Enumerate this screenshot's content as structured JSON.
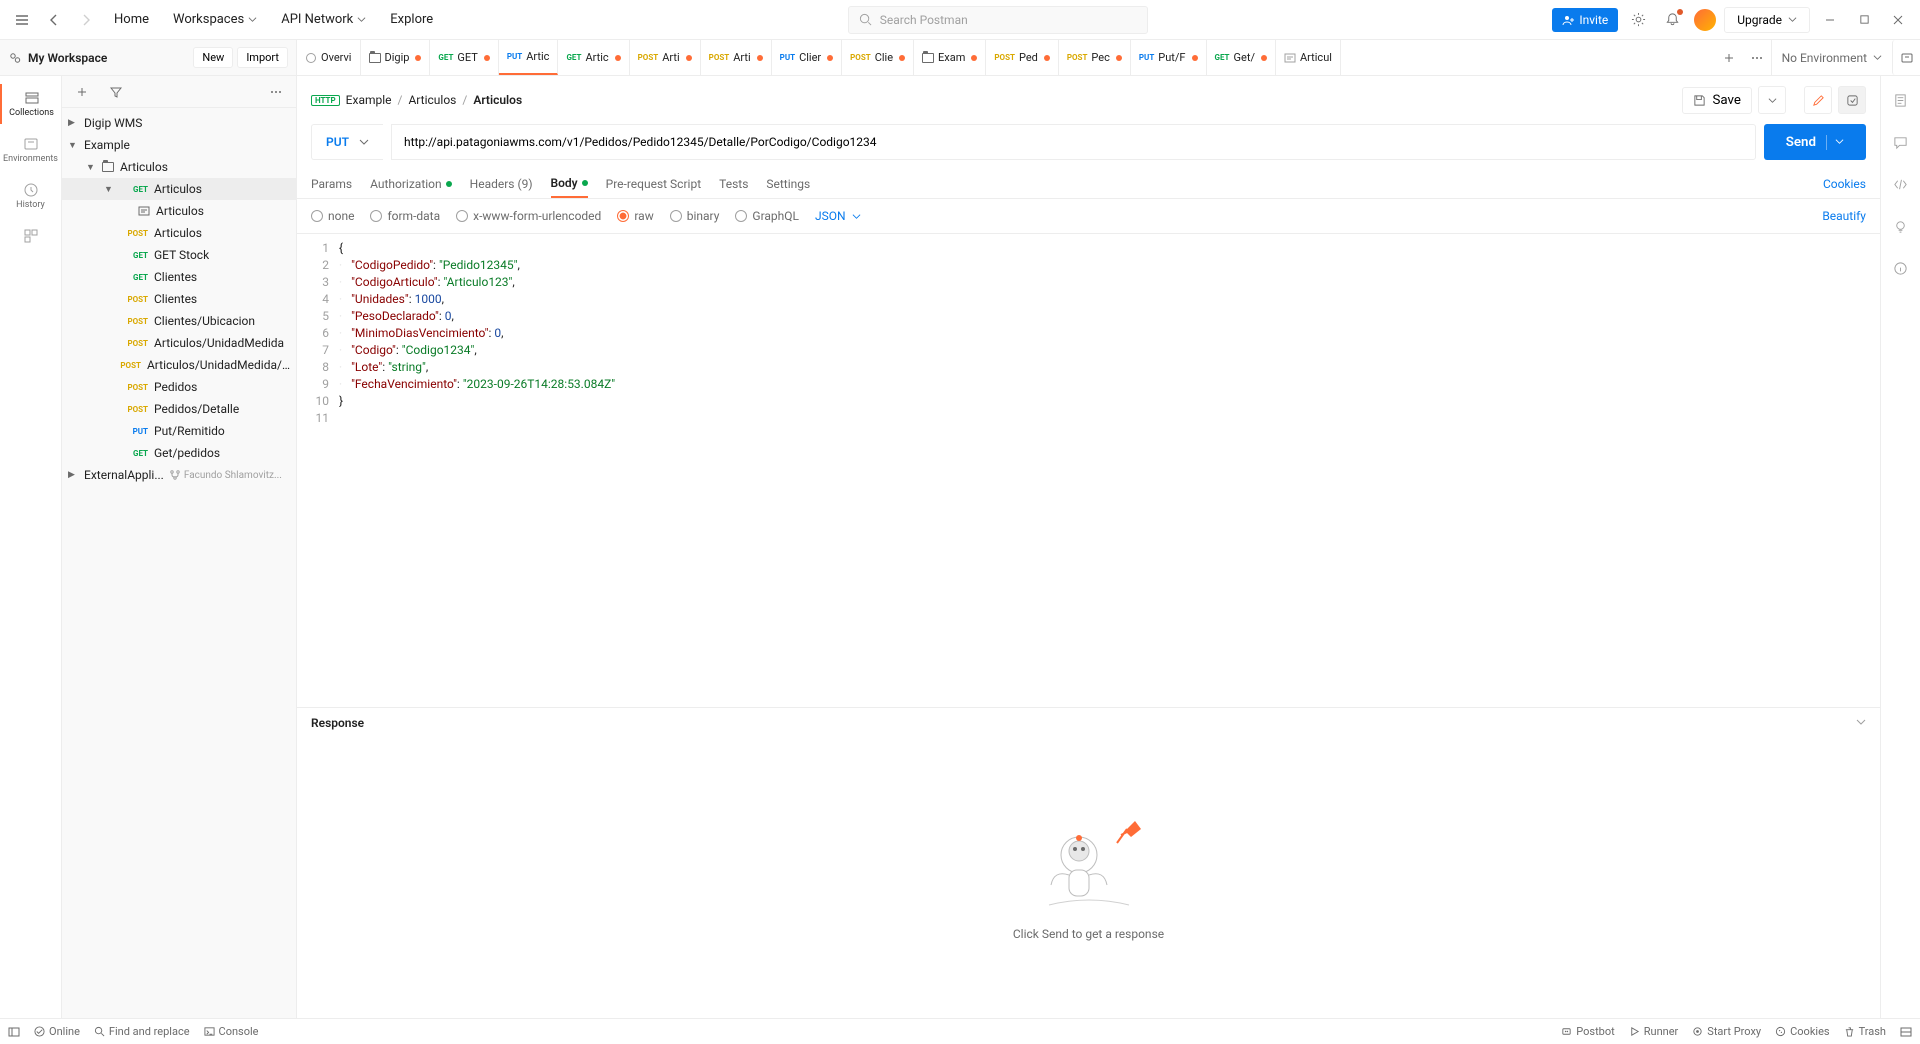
{
  "header": {
    "home": "Home",
    "workspaces": "Workspaces",
    "api_network": "API Network",
    "explore": "Explore",
    "search_placeholder": "Search Postman",
    "invite": "Invite",
    "upgrade": "Upgrade"
  },
  "workspace": {
    "name": "My Workspace",
    "new_btn": "New",
    "import_btn": "Import",
    "no_env": "No Environment"
  },
  "rail": {
    "collections": "Collections",
    "environments": "Environments",
    "history": "History"
  },
  "tabs": [
    {
      "method": null,
      "label": "Overvi",
      "dirty": false,
      "icon": "overview"
    },
    {
      "method": null,
      "label": "Digip",
      "dirty": true,
      "icon": "folder"
    },
    {
      "method": "GET",
      "label": "GET",
      "dirty": true
    },
    {
      "method": "PUT",
      "label": "Artic",
      "dirty": false,
      "active": true
    },
    {
      "method": "GET",
      "label": "Artic",
      "dirty": true
    },
    {
      "method": "POST",
      "label": "Arti",
      "dirty": true
    },
    {
      "method": "POST",
      "label": "Arti",
      "dirty": true
    },
    {
      "method": "PUT",
      "label": "Clier",
      "dirty": true
    },
    {
      "method": "POST",
      "label": "Clie",
      "dirty": true
    },
    {
      "method": null,
      "label": "Exam",
      "dirty": true,
      "icon": "folder"
    },
    {
      "method": "POST",
      "label": "Ped",
      "dirty": true
    },
    {
      "method": "POST",
      "label": "Pec",
      "dirty": true
    },
    {
      "method": "PUT",
      "label": "Put/F",
      "dirty": true
    },
    {
      "method": "GET",
      "label": "Get/",
      "dirty": true
    },
    {
      "method": null,
      "label": "Articul",
      "dirty": false,
      "icon": "example"
    }
  ],
  "tree": [
    {
      "type": "col",
      "label": "Digip WMS",
      "indent": 0,
      "caret": "right"
    },
    {
      "type": "col",
      "label": "Example",
      "indent": 0,
      "caret": "down"
    },
    {
      "type": "folder",
      "label": "Articulos",
      "indent": 1,
      "caret": "down"
    },
    {
      "type": "req",
      "method": "GET",
      "label": "Articulos",
      "indent": 2,
      "caret": "down",
      "selected": true
    },
    {
      "type": "ex",
      "label": "Articulos",
      "indent": 3
    },
    {
      "type": "req",
      "method": "POST",
      "label": "Articulos",
      "indent": 2
    },
    {
      "type": "req",
      "method": "GET",
      "label": "GET Stock",
      "indent": 2
    },
    {
      "type": "req",
      "method": "GET",
      "label": "Clientes",
      "indent": 2
    },
    {
      "type": "req",
      "method": "POST",
      "label": "Clientes",
      "indent": 2
    },
    {
      "type": "req",
      "method": "POST",
      "label": "Clientes/Ubicacion",
      "indent": 2
    },
    {
      "type": "req",
      "method": "POST",
      "label": "Articulos/UnidadMedida",
      "indent": 2
    },
    {
      "type": "req",
      "method": "POST",
      "label": "Articulos/UnidadMedida/Codig...",
      "indent": 2
    },
    {
      "type": "req",
      "method": "POST",
      "label": "Pedidos",
      "indent": 2
    },
    {
      "type": "req",
      "method": "POST",
      "label": "Pedidos/Detalle",
      "indent": 2
    },
    {
      "type": "req",
      "method": "PUT",
      "label": "Put/Remitido",
      "indent": 2
    },
    {
      "type": "req",
      "method": "GET",
      "label": "Get/pedidos",
      "indent": 2
    },
    {
      "type": "col",
      "label": "ExternalAppli...",
      "indent": 0,
      "caret": "right",
      "fork": "Facundo Shlamovitz..."
    }
  ],
  "breadcrumb": {
    "api_badge": "HTTP",
    "seg1": "Example",
    "seg2": "Articulos",
    "seg3": "Articulos",
    "sep": "/"
  },
  "request": {
    "method": "PUT",
    "url": "http://api.patagoniawms.com/v1/Pedidos/Pedido12345/Detalle/PorCodigo/Codigo1234",
    "send": "Send",
    "save": "Save"
  },
  "req_tabs": {
    "params": "Params",
    "auth": "Authorization",
    "headers": "Headers (9)",
    "body": "Body",
    "prescript": "Pre-request Script",
    "tests": "Tests",
    "settings": "Settings",
    "cookies": "Cookies"
  },
  "body_opts": {
    "none": "none",
    "form": "form-data",
    "url": "x-www-form-urlencoded",
    "raw": "raw",
    "binary": "binary",
    "gql": "GraphQL",
    "json": "JSON",
    "beautify": "Beautify"
  },
  "code_lines": [
    [
      [
        "p",
        "{"
      ]
    ],
    [
      [
        "key",
        "\"CodigoPedido\""
      ],
      [
        "p",
        ": "
      ],
      [
        "str",
        "\"Pedido12345\""
      ],
      [
        "p",
        ","
      ]
    ],
    [
      [
        "key",
        "\"CodigoArticulo\""
      ],
      [
        "p",
        ": "
      ],
      [
        "str",
        "\"Articulo123\""
      ],
      [
        "p",
        ","
      ]
    ],
    [
      [
        "key",
        "\"Unidades\""
      ],
      [
        "p",
        ": "
      ],
      [
        "num",
        "1000"
      ],
      [
        "p",
        ","
      ]
    ],
    [
      [
        "key",
        "\"PesoDeclarado\""
      ],
      [
        "p",
        ": "
      ],
      [
        "num",
        "0"
      ],
      [
        "p",
        ","
      ]
    ],
    [
      [
        "key",
        "\"MinimoDiasVencimiento\""
      ],
      [
        "p",
        ": "
      ],
      [
        "num",
        "0"
      ],
      [
        "p",
        ","
      ]
    ],
    [
      [
        "key",
        "\"Codigo\""
      ],
      [
        "p",
        ": "
      ],
      [
        "str",
        "\"Codigo1234\""
      ],
      [
        "p",
        ","
      ]
    ],
    [
      [
        "key",
        "\"Lote\""
      ],
      [
        "p",
        ": "
      ],
      [
        "str",
        "\"string\""
      ],
      [
        "p",
        ","
      ]
    ],
    [
      [
        "key",
        "\"FechaVencimiento\""
      ],
      [
        "p",
        ": "
      ],
      [
        "str",
        "\"2023-09-26T14:28:53.084Z\""
      ]
    ],
    [
      [
        "p",
        "}"
      ]
    ],
    []
  ],
  "response": {
    "title": "Response",
    "hint": "Click Send to get a response"
  },
  "statusbar": {
    "online": "Online",
    "find": "Find and replace",
    "console": "Console",
    "postbot": "Postbot",
    "runner": "Runner",
    "proxy": "Start Proxy",
    "cookies": "Cookies",
    "trash": "Trash"
  }
}
